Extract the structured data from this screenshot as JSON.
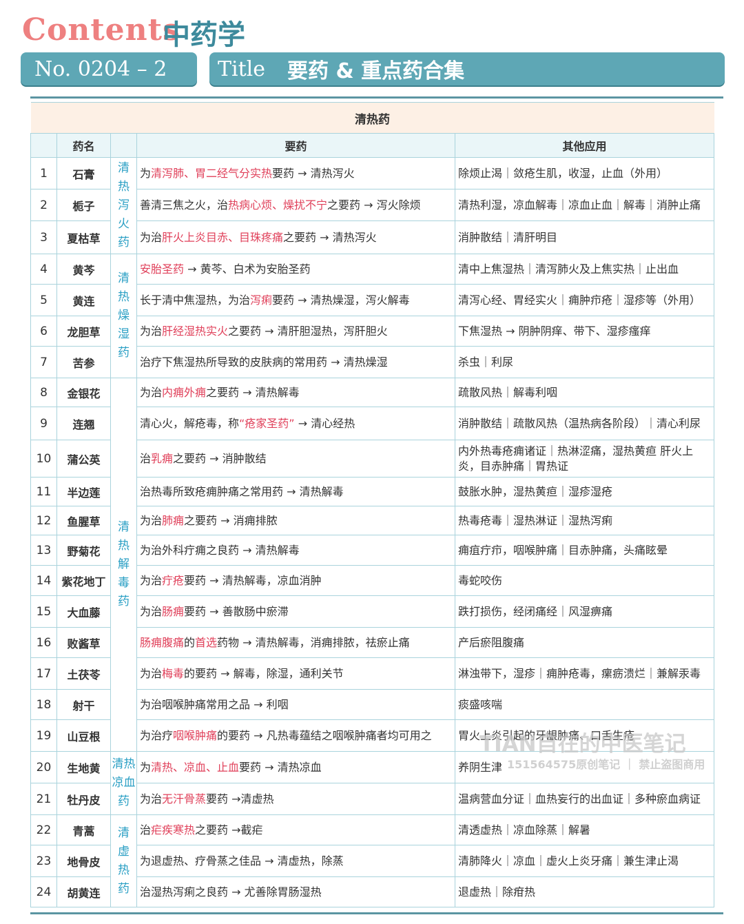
{
  "header": {
    "contents": "Contents",
    "subject": "中药学",
    "number": "No. 0204 – 2",
    "title_label": "Title",
    "title_value": "要药 & 重点药合集"
  },
  "table": {
    "section_title": "清热药",
    "columns": [
      "",
      "药名",
      "",
      "要药",
      "其他应用"
    ],
    "categories": [
      {
        "label": "清热泻火药",
        "chars": [
          "清",
          "热",
          "泻",
          "火",
          "药"
        ],
        "rowspan": 3
      },
      {
        "label": "清热燥湿药",
        "chars": [
          "清",
          "热",
          "燥",
          "湿",
          "药"
        ],
        "rowspan": 4
      },
      {
        "label": "清热解毒药",
        "chars": [
          "清",
          "热",
          "解",
          "毒",
          "药"
        ],
        "rowspan": 12
      },
      {
        "label": "清热凉血药",
        "chars": [
          "清热",
          "凉血",
          "药"
        ],
        "rowspan": 2
      },
      {
        "label": "清虚热药",
        "chars": [
          "清",
          "虚",
          "热",
          "药"
        ],
        "rowspan": 3
      }
    ],
    "rows": [
      {
        "num": "1",
        "name": "石膏",
        "key": [
          {
            "t": "为"
          },
          {
            "t": "清泻肺、胃二经气分实热",
            "r": true
          },
          {
            "t": "要药 → 清热泻火"
          }
        ],
        "other": "除烦止渴｜敛疮生肌，收湿，止血（外用）"
      },
      {
        "num": "2",
        "name": "栀子",
        "key": [
          {
            "t": "善清三焦之火，治"
          },
          {
            "t": "热病心烦、燥扰不宁",
            "r": true
          },
          {
            "t": "之要药 → 泻火除烦"
          }
        ],
        "other": "清热利湿，凉血解毒｜凉血止血｜解毒｜消肿止痛"
      },
      {
        "num": "3",
        "name": "夏枯草",
        "key": [
          {
            "t": "为治"
          },
          {
            "t": "肝火上炎目赤、目珠疼痛",
            "r": true
          },
          {
            "t": "之要药 → 清热泻火"
          }
        ],
        "other": "消肿散结｜清肝明目"
      },
      {
        "num": "4",
        "name": "黄芩",
        "key": [
          {
            "t": "安胎圣药",
            "r": true
          },
          {
            "t": " → 黄芩、白术为安胎圣药"
          }
        ],
        "other": "清中上焦湿热｜清泻肺火及上焦实热｜止出血"
      },
      {
        "num": "5",
        "name": "黄连",
        "key": [
          {
            "t": "长于清中焦湿热，为治"
          },
          {
            "t": "泻痢",
            "r": true
          },
          {
            "t": "要药 → 清热燥湿，泻火解毒"
          }
        ],
        "other": "清泻心经、胃经实火｜痈肿疖疮｜湿疹等（外用）"
      },
      {
        "num": "6",
        "name": "龙胆草",
        "key": [
          {
            "t": "为治"
          },
          {
            "t": "肝经湿热实火",
            "r": true
          },
          {
            "t": "之要药 → 清肝胆湿热，泻肝胆火"
          }
        ],
        "other": "下焦湿热 → 阴肿阴痒、带下、湿疹瘙痒"
      },
      {
        "num": "7",
        "name": "苦参",
        "key": [
          {
            "t": "治疗下焦湿热所导致的皮肤病的常用药 → 清热燥湿"
          }
        ],
        "other": "杀虫｜利尿"
      },
      {
        "num": "8",
        "name": "金银花",
        "key": [
          {
            "t": "为治"
          },
          {
            "t": "内痈外痈",
            "r": true
          },
          {
            "t": "之要药 → 清热解毒"
          }
        ],
        "other": "疏散风热｜解毒利咽"
      },
      {
        "num": "9",
        "name": "连翘",
        "key": [
          {
            "t": "清心火，解疮毒，称"
          },
          {
            "t": "“疮家圣药”",
            "r": true
          },
          {
            "t": " → 清心经热"
          }
        ],
        "other": "消肿散结｜疏散风热（温热病各阶段）｜清心利尿"
      },
      {
        "num": "10",
        "name": "蒲公英",
        "key": [
          {
            "t": "治"
          },
          {
            "t": "乳痈",
            "r": true
          },
          {
            "t": "之要药 → 消肿散结"
          }
        ],
        "other": "内外热毒疮痈诸证｜热淋涩痛，湿热黄疸 肝火上炎，目赤肿痛｜胃热证"
      },
      {
        "num": "11",
        "name": "半边莲",
        "key": [
          {
            "t": "治热毒所致疮痈肿痛之常用药 → 清热解毒"
          }
        ],
        "other": "鼓胀水肿，湿热黄疸｜湿疹湿疮"
      },
      {
        "num": "12",
        "name": "鱼腥草",
        "key": [
          {
            "t": "为治"
          },
          {
            "t": "肺痈",
            "r": true
          },
          {
            "t": "之要药 → 消痈排脓"
          }
        ],
        "other": "热毒疮毒｜湿热淋证｜湿热泻痢"
      },
      {
        "num": "13",
        "name": "野菊花",
        "key": [
          {
            "t": "为治外科疔痈之良药 → 清热解毒"
          }
        ],
        "other": "痈疽疔疖，咽喉肿痛｜目赤肿痛，头痛眩晕"
      },
      {
        "num": "14",
        "name": "紫花地丁",
        "key": [
          {
            "t": "为治"
          },
          {
            "t": "疔疮",
            "r": true
          },
          {
            "t": "要药 → 清热解毒，凉血消肿"
          }
        ],
        "other": "毒蛇咬伤"
      },
      {
        "num": "15",
        "name": "大血藤",
        "key": [
          {
            "t": "为治"
          },
          {
            "t": "肠痈",
            "r": true
          },
          {
            "t": "要药 → 善散肠中瘀滞"
          }
        ],
        "other": "跌打损伤，经闭痛经｜风湿痹痛"
      },
      {
        "num": "16",
        "name": "败酱草",
        "key": [
          {
            "t": "肠痈腹痛",
            "r": true
          },
          {
            "t": "的"
          },
          {
            "t": "首选",
            "r": true
          },
          {
            "t": "药物 → 清热解毒，消痈排脓，祛瘀止痛"
          }
        ],
        "other": "产后瘀阻腹痛"
      },
      {
        "num": "17",
        "name": "土茯苓",
        "key": [
          {
            "t": "为治"
          },
          {
            "t": "梅毒",
            "r": true
          },
          {
            "t": "的要药 → 解毒，除湿，通利关节"
          }
        ],
        "other": "淋浊带下，湿疹｜痈肿疮毒，瘰疬溃烂｜兼解汞毒"
      },
      {
        "num": "18",
        "name": "射干",
        "key": [
          {
            "t": "为治咽喉肿痛常用之品 → 利咽"
          }
        ],
        "other": "痰盛咳喘"
      },
      {
        "num": "19",
        "name": "山豆根",
        "key": [
          {
            "t": "为治疗"
          },
          {
            "t": "咽喉肿痛",
            "r": true
          },
          {
            "t": "的要药 → 凡热毒蕴结之咽喉肿痛者均可用之"
          }
        ],
        "other": "胃火上炎引起的牙龈肿痛、口舌生疮"
      },
      {
        "num": "20",
        "name": "生地黄",
        "key": [
          {
            "t": "为"
          },
          {
            "t": "清热、凉血、止血",
            "r": true
          },
          {
            "t": "要药 → 清热凉血"
          }
        ],
        "other": "养阴生津"
      },
      {
        "num": "21",
        "name": "牡丹皮",
        "key": [
          {
            "t": "为治"
          },
          {
            "t": "无汗骨蒸",
            "r": true
          },
          {
            "t": "要药 →清虚热"
          }
        ],
        "other": "温病营血分证｜血热妄行的出血证｜多种瘀血病证"
      },
      {
        "num": "22",
        "name": "青蒿",
        "key": [
          {
            "t": "治"
          },
          {
            "t": "疟疾寒热",
            "r": true
          },
          {
            "t": "之要药 →截疟"
          }
        ],
        "other": "清透虚热｜凉血除蒸｜解暑"
      },
      {
        "num": "23",
        "name": "地骨皮",
        "key": [
          {
            "t": "为退虚热、疗骨蒸之佳品 → 清虚热，除蒸"
          }
        ],
        "other": "清肺降火｜凉血｜虚火上炎牙痛｜兼生津止渴"
      },
      {
        "num": "24",
        "name": "胡黄连",
        "key": [
          {
            "t": "治湿热泻痢之良药 → 尤善除胃肠湿热"
          }
        ],
        "other": "退虚热｜除疳热"
      }
    ]
  },
  "watermark": {
    "line1": "TIAN自在的中医笔记",
    "line2": "151564575原创笔记 ｜ 禁止盗图商用"
  },
  "colors": {
    "accent": "#5ea7b5",
    "highlight": "#e0405a",
    "category": "#2a9fc4",
    "contents": "#ee8080"
  }
}
